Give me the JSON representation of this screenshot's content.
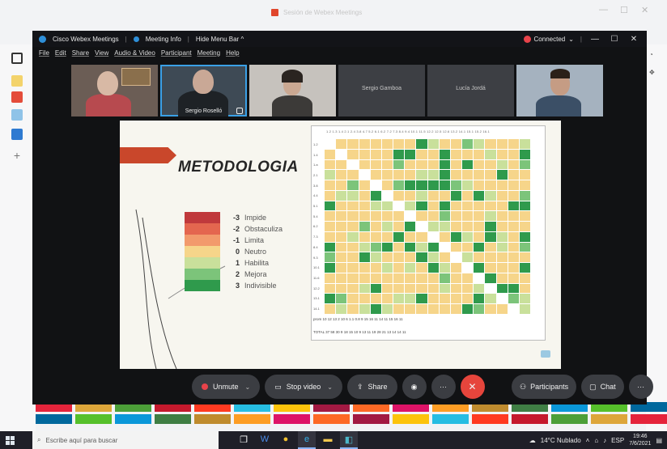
{
  "browser": {
    "tab_title": "Sesión de Webex Meetings"
  },
  "webex": {
    "app_title": "Cisco Webex Meetings",
    "meeting_info": "Meeting Info",
    "hide_menu_bar": "Hide Menu Bar ^",
    "connection_status": "Connected",
    "menu": [
      "File",
      "Edit",
      "Share",
      "View",
      "Audio & Video",
      "Participant",
      "Meeting",
      "Help"
    ],
    "participants": [
      {
        "name": "",
        "kind": "video"
      },
      {
        "name": "Sergio Roselló",
        "kind": "video",
        "selected": true
      },
      {
        "name": "",
        "kind": "video"
      },
      {
        "name": "Sergio Gamboa",
        "kind": "name-only"
      },
      {
        "name": "Lucía Jordá",
        "kind": "name-only"
      },
      {
        "name": "",
        "kind": "video"
      }
    ],
    "controls": {
      "unmute": "Unmute",
      "stop_video": "Stop video",
      "share": "Share",
      "participants": "Participants",
      "chat": "Chat"
    }
  },
  "slide": {
    "title": "METODOLOGIA",
    "legend": [
      {
        "value": "-3",
        "label": "Impide",
        "color": "#c0393c"
      },
      {
        "value": "-2",
        "label": "Obstaculiza",
        "color": "#e4664f"
      },
      {
        "value": "-1",
        "label": "Limita",
        "color": "#f29a6c"
      },
      {
        "value": "0",
        "label": "Neutro",
        "color": "#f6d58a"
      },
      {
        "value": "1",
        "label": "Habilita",
        "color": "#c9e09b"
      },
      {
        "value": "2",
        "label": "Mejora",
        "color": "#7cc47a"
      },
      {
        "value": "3",
        "label": "Indivisible",
        "color": "#2f9a4c"
      }
    ],
    "matrix_header": "1.2  1.3  1.4  2.1  2.4  3.8  4.7  5.2  6.1  6.2  7.2  7.3  8.4  9.4  10.1 11.5 12.2 12.5 12.6 13.2 14.1 15.1 15.2 16.1",
    "matrix_row_labels": [
      "1.2",
      "1.4",
      "1.a",
      "2.1",
      "3.8",
      "4.4",
      "5.1",
      "5.4",
      "6.2",
      "7.3",
      "8.4",
      "9.3",
      "10.1",
      "11.6",
      "12.2",
      "13.1",
      "14.1"
    ],
    "matrix_foot1": "prom  10  12  13  2   10  6   1.1  0.8  9   15  16  11  14  11  15  16  11",
    "matrix_foot2": "TOTAL  37  58  30  9  18  15  10  9  13  11  19  28  21  13  14  14  11"
  },
  "taskbar": {
    "search_placeholder": "Escribe aquí para buscar",
    "weather": "14°C  Nublado",
    "language": "ESP",
    "time": "19:46",
    "date": "7/6/2021"
  }
}
